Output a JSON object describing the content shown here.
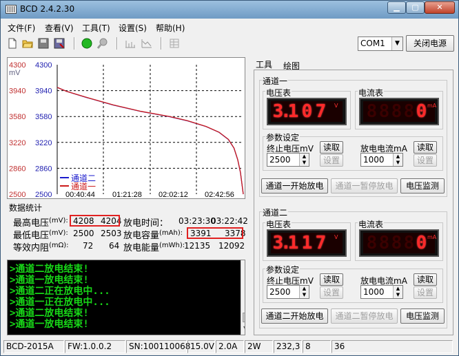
{
  "window": {
    "title": "BCD 2.4.2.30",
    "min": "▁",
    "max": "▢",
    "close": "✕"
  },
  "menu": [
    "文件(F)",
    "查看(V)",
    "工具(T)",
    "设置(S)",
    "帮助(H)"
  ],
  "toolbar": {
    "port": "COM1",
    "power_button": "关闭电源"
  },
  "tabs": {
    "tools": "工具",
    "plot": "绘图"
  },
  "chart_data": {
    "type": "line",
    "ylabel_left": "mV",
    "ylim": [
      2500,
      4300
    ],
    "yticks_left": [
      "4300",
      "3940",
      "3580",
      "3220",
      "2860",
      "2500"
    ],
    "yticks_right": [
      "4300",
      "3940",
      "3580",
      "3220",
      "2860",
      "2500"
    ],
    "xticks": [
      "00:40:44",
      "01:21:28",
      "02:02:12",
      "02:42:56"
    ],
    "series": [
      {
        "name": "通道二",
        "color": "#1a1acc",
        "x": [
          0,
          0.05,
          0.15,
          0.3,
          0.45,
          0.6,
          0.7,
          0.8,
          0.87,
          0.92,
          0.95,
          0.97,
          0.985,
          1.0
        ],
        "values": [
          3985,
          3930,
          3850,
          3740,
          3650,
          3580,
          3520,
          3440,
          3360,
          3260,
          3140,
          2980,
          2800,
          2500
        ]
      },
      {
        "name": "通道一",
        "color": "#cc1a1a",
        "x": [
          0,
          0.05,
          0.15,
          0.3,
          0.45,
          0.6,
          0.7,
          0.8,
          0.87,
          0.92,
          0.95,
          0.97,
          0.985,
          1.0
        ],
        "values": [
          3985,
          3930,
          3852,
          3742,
          3652,
          3582,
          3522,
          3442,
          3362,
          3262,
          3142,
          2982,
          2802,
          2500
        ]
      }
    ]
  },
  "stats": {
    "title": "数据统计",
    "max_v_label": "最高电压",
    "max_v_unit": "(mV):",
    "max_v_ch1": "4208",
    "max_v_ch2": "4204",
    "time_label": "放电时间：",
    "time_ch1": "03:23:30",
    "time_ch2": "03:22:42",
    "min_v_label": "最低电压",
    "min_v_unit": "(mV):",
    "min_v_ch1": "2500",
    "min_v_ch2": "2503",
    "cap_label": "放电容量",
    "cap_unit": "(mAh):",
    "cap_ch1": "3391",
    "cap_ch2": "3378",
    "res_label": "等效内阻",
    "res_unit": "(mΩ):",
    "res_ch1": "72",
    "res_ch2": "64",
    "energy_label": "放电能量",
    "energy_unit": "(mWh):",
    "energy_ch1": "12135",
    "energy_ch2": "12092"
  },
  "console": [
    ">通道二放电结束!",
    ">通道一放电结束!",
    ">通道二正在放电中...",
    ">通道一正在放电中...",
    ">通道二放电结束!",
    ">通道一放电结束!"
  ],
  "statusbar": [
    "BCD-2015A",
    "FW:1.0.0.2",
    "SN:100110068",
    "15.0V",
    "2.0A",
    "2W",
    "232,3",
    "8",
    "36"
  ],
  "channel1": {
    "title": "通道一",
    "voltmeter": "电压表",
    "ammeter": "电流表",
    "v_digits": [
      "3",
      ".",
      "1",
      "0",
      "7"
    ],
    "v_unit": "V",
    "a_digits": [
      "8",
      "8",
      "8",
      "8",
      "0"
    ],
    "a_unit": "mA",
    "params": "参数设定",
    "stop_v_label": "终止电压mV",
    "stop_v": "2500",
    "cur_label": "放电电流mA",
    "cur": "1000",
    "read": "读取",
    "set": "设置",
    "start": "通道一开始放电",
    "pause": "通道一暂停放电",
    "monitor": "电压监测"
  },
  "channel2": {
    "title": "通道二",
    "voltmeter": "电压表",
    "ammeter": "电流表",
    "v_digits": [
      "3",
      ".",
      "1",
      "1",
      "7"
    ],
    "v_unit": "V",
    "a_digits": [
      "8",
      "8",
      "8",
      "8",
      "0"
    ],
    "a_unit": "mA",
    "params": "参数设定",
    "stop_v_label": "终止电压mV",
    "stop_v": "2500",
    "cur_label": "放电电流mA",
    "cur": "1000",
    "read": "读取",
    "set": "设置",
    "start": "通道二开始放电",
    "pause": "通道二暂停放电",
    "monitor": "电压监测"
  },
  "colors": {
    "accent": "#1a1acc",
    "alert": "#e02020",
    "console": "#18d818"
  }
}
